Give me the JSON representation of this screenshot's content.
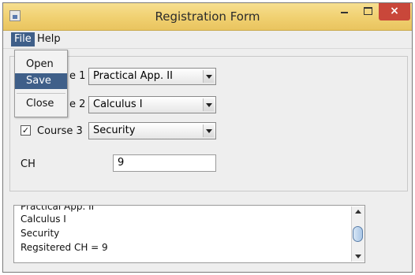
{
  "window": {
    "title": "Registration Form",
    "close_glyph": "×"
  },
  "menubar": {
    "file": "File",
    "help": "Help"
  },
  "file_menu": {
    "items": [
      "Open",
      "Save",
      "Close"
    ],
    "selected": "Save"
  },
  "courses": [
    {
      "label_visible": "e 1",
      "value": "Practical App. II"
    },
    {
      "label_visible": "e 2",
      "value": "Calculus I"
    },
    {
      "label": "Course 3",
      "value": "Security",
      "checked": true
    }
  ],
  "checkbox_glyph": "✓",
  "ch": {
    "label": "CH",
    "value": "9"
  },
  "output": {
    "lines": [
      "Practical App. II",
      "Calculus I",
      "Security",
      "Regsitered CH = 9"
    ]
  },
  "colors": {
    "titlebar": "#f0d070",
    "close": "#c9473a",
    "menu_highlight": "#3f5f89"
  }
}
